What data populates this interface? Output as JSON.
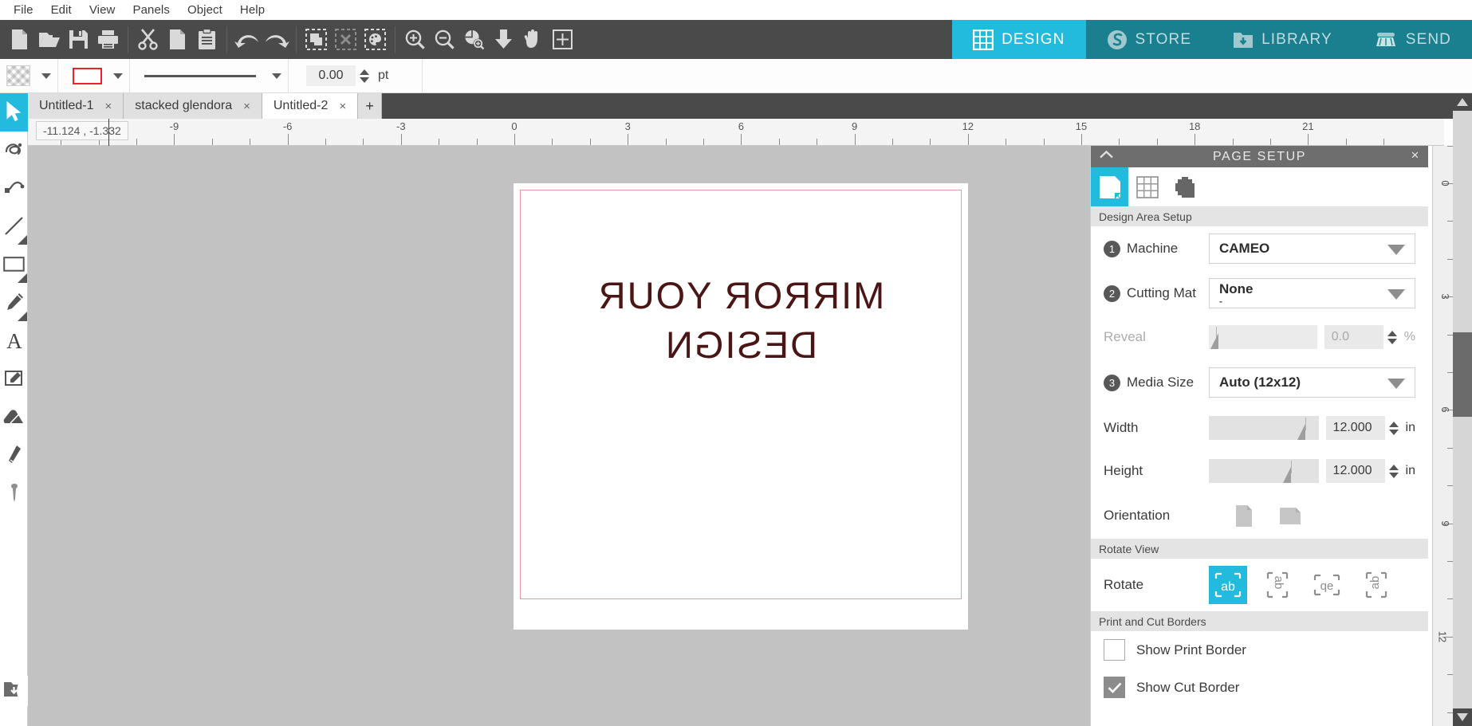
{
  "menu": {
    "items": [
      "File",
      "Edit",
      "View",
      "Panels",
      "Object",
      "Help"
    ]
  },
  "toolbar": {
    "groups": [
      {
        "name": "file",
        "buttons": [
          {
            "icon": "new-document-icon",
            "label": "New"
          },
          {
            "icon": "open-folder-icon",
            "label": "Open"
          },
          {
            "icon": "save-disk-icon",
            "label": "Save"
          },
          {
            "icon": "print-icon",
            "label": "Print"
          }
        ]
      },
      {
        "name": "clipboard",
        "buttons": [
          {
            "icon": "scissors-cut-icon",
            "label": "Cut"
          },
          {
            "icon": "copy-icon",
            "label": "Copy"
          },
          {
            "icon": "paste-clipboard-icon",
            "label": "Paste"
          }
        ]
      },
      {
        "name": "history",
        "buttons": [
          {
            "icon": "undo-arrow-icon",
            "label": "Undo"
          },
          {
            "icon": "redo-arrow-icon",
            "label": "Redo"
          }
        ]
      },
      {
        "name": "selection",
        "buttons": [
          {
            "icon": "select-all-icon",
            "label": "Select All"
          },
          {
            "icon": "deselect-all-icon",
            "label": "Deselect All"
          },
          {
            "icon": "select-by-color-icon",
            "label": "Select by Color"
          }
        ]
      },
      {
        "name": "view",
        "buttons": [
          {
            "icon": "zoom-in-icon",
            "label": "Zoom In"
          },
          {
            "icon": "zoom-out-icon",
            "label": "Zoom Out"
          },
          {
            "icon": "zoom-to-selection-icon",
            "label": "Zoom to Selection"
          },
          {
            "icon": "fit-to-page-icon",
            "label": "Fit to Page"
          },
          {
            "icon": "pan-hand-icon",
            "label": "Pan"
          },
          {
            "icon": "fit-to-window-icon",
            "label": "Fit to Window"
          }
        ]
      }
    ]
  },
  "nav_tabs": [
    {
      "label": "DESIGN",
      "icon": "grid-design-icon",
      "active": true
    },
    {
      "label": "STORE",
      "icon": "store-swirl-icon",
      "active": false
    },
    {
      "label": "LIBRARY",
      "icon": "library-folder-icon",
      "active": false
    },
    {
      "label": "SEND",
      "icon": "send-cutter-icon",
      "active": false
    }
  ],
  "style_bar": {
    "fill_swatch_name": "fill-color-swatch",
    "line_swatch_name": "line-color-swatch",
    "line_color": "#ee2222",
    "stroke_style_name": "line-style-preview",
    "line_width_value": "0.00",
    "line_width_unit": "pt"
  },
  "doc_tabs": {
    "tabs": [
      {
        "title": "Untitled-1",
        "active": false,
        "closable": true
      },
      {
        "title": "stacked glendora",
        "active": false,
        "closable": true
      },
      {
        "title": "Untitled-2",
        "active": true,
        "closable": true
      }
    ],
    "close_glyph": "×",
    "add_glyph": "+"
  },
  "left_rail": {
    "tools": [
      {
        "name": "select-arrow-tool",
        "icon": "cursor-arrow-icon",
        "active": true,
        "has_flyout": false
      },
      {
        "name": "edit-points-tool",
        "icon": "knot-points-icon",
        "active": false,
        "has_flyout": false
      },
      {
        "name": "draw-curve-tool",
        "icon": "curve-pen-icon",
        "active": false,
        "has_flyout": false
      },
      {
        "name": "line-tool",
        "icon": "line-icon",
        "active": false,
        "has_flyout": true
      },
      {
        "name": "rectangle-tool",
        "icon": "rectangle-icon",
        "active": false,
        "has_flyout": true
      },
      {
        "name": "draw-freehand-tool",
        "icon": "pencil-icon",
        "active": false,
        "has_flyout": true
      },
      {
        "name": "text-tool",
        "icon": "text-a-icon",
        "active": false,
        "has_flyout": false
      },
      {
        "name": "notes-tool",
        "icon": "note-pen-icon",
        "active": false,
        "has_flyout": false
      },
      {
        "name": "eraser-tool",
        "icon": "eraser-icon",
        "active": false,
        "has_flyout": false
      },
      {
        "name": "knife-tool",
        "icon": "knife-icon",
        "active": false,
        "has_flyout": false
      },
      {
        "name": "eyedropper-tool",
        "icon": "eyedropper-icon",
        "active": false,
        "has_flyout": false
      }
    ],
    "bottom_button": {
      "name": "library-download-button",
      "icon": "download-folder-icon"
    },
    "flyout_button": {
      "name": "panel-expand-button",
      "icon": "play-triangle-icon"
    }
  },
  "rulers": {
    "cursor_position": "-11.124 , -1.332",
    "h_labels": [
      "-9",
      "-6",
      "-3",
      "0",
      "3",
      "6",
      "9",
      "12",
      "15",
      "18",
      "21"
    ],
    "v_labels": [
      "0",
      "3",
      "6",
      "9",
      "12"
    ],
    "unit": "in"
  },
  "canvas": {
    "artwork_lines": [
      "MIRROR YOUR",
      "DESIGN"
    ],
    "artwork_color": "#4a1515",
    "cut_border_color": "#e79aa0",
    "page_background": "#ffffff",
    "workspace_background": "#c2c2c2",
    "orientation_marker": "up-arrow-icon"
  },
  "page_setup": {
    "title": "PAGE SETUP",
    "close_glyph": "×",
    "tab_icons": [
      {
        "name": "page-tab-icon",
        "active": true
      },
      {
        "name": "grid-tab-icon",
        "active": false
      },
      {
        "name": "registration-tab-icon",
        "active": false
      }
    ],
    "sections": {
      "design_area": "Design Area Setup",
      "rotate_view": "Rotate View",
      "print_cut": "Print and Cut Borders"
    },
    "machine": {
      "step": "1",
      "label": "Machine",
      "value": "CAMEO"
    },
    "cutting_mat": {
      "step": "2",
      "label": "Cutting Mat",
      "value": "None",
      "sub_value": "-"
    },
    "reveal": {
      "label": "Reveal",
      "value": "0.0",
      "unit": "%",
      "disabled": true
    },
    "media_size": {
      "step": "3",
      "label": "Media Size",
      "value": "Auto (12x12)"
    },
    "width": {
      "label": "Width",
      "value": "12.000",
      "unit": "in"
    },
    "height": {
      "label": "Height",
      "value": "12.000",
      "unit": "in"
    },
    "orientation": {
      "label": "Orientation",
      "options": [
        {
          "name": "orientation-portrait-button",
          "active": false
        },
        {
          "name": "orientation-landscape-button",
          "active": false
        }
      ]
    },
    "rotate": {
      "label": "Rotate",
      "options": [
        {
          "name": "rotate-0-button",
          "glyph": "ab",
          "active": true
        },
        {
          "name": "rotate-90-button",
          "glyph": "ab",
          "active": false
        },
        {
          "name": "rotate-180-button",
          "glyph": "qe",
          "active": false
        },
        {
          "name": "rotate-270-button",
          "glyph": "ab",
          "active": false
        }
      ]
    },
    "checkboxes": [
      {
        "name": "show-print-border-checkbox",
        "label": "Show Print Border",
        "checked": false
      },
      {
        "name": "show-cut-border-checkbox",
        "label": "Show Cut Border",
        "checked": true
      }
    ]
  },
  "colors": {
    "accent": "#22bbdd",
    "toolbar_dark": "#4a4a4a",
    "nav_inactive": "#1a7f8e",
    "panel_header": "#6e6e6e"
  }
}
